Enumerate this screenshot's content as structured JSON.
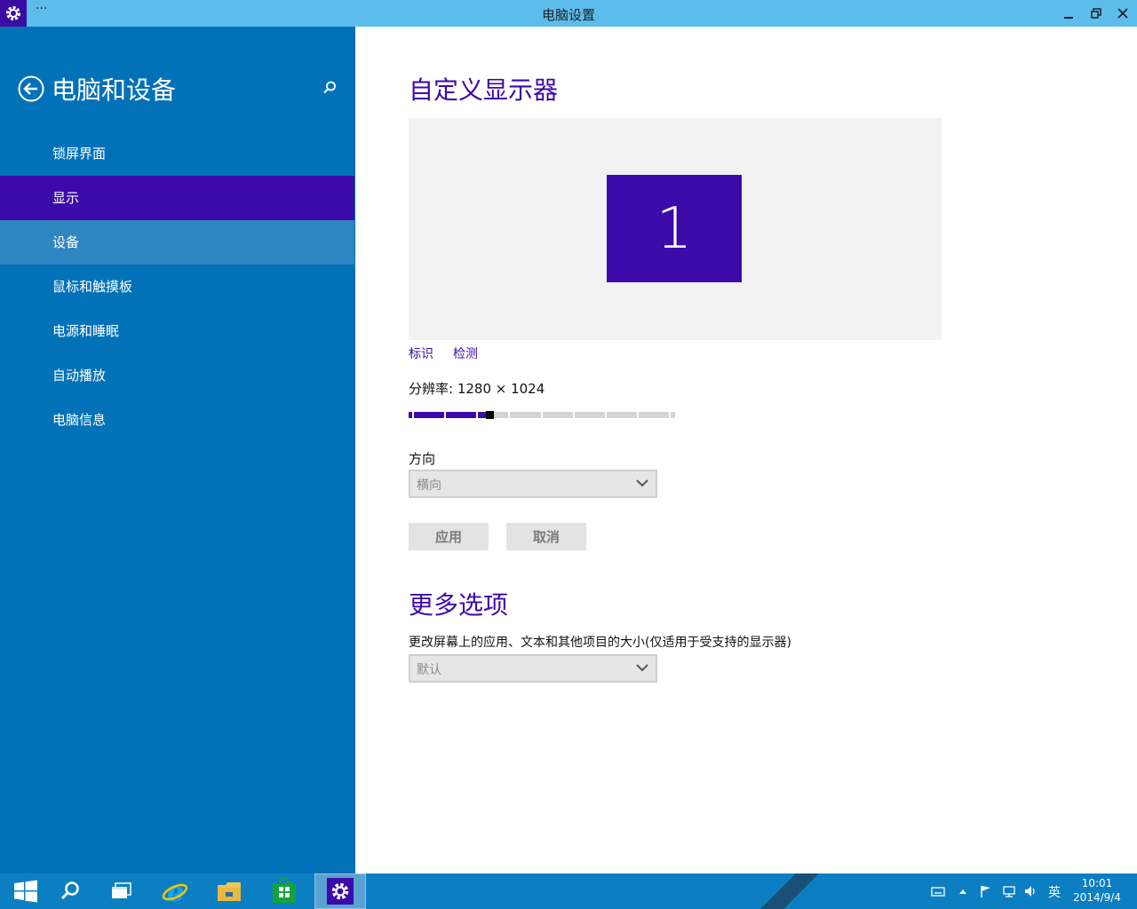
{
  "window": {
    "title": "电脑设置",
    "menu_dots": "···"
  },
  "sidebar": {
    "title": "电脑和设备",
    "items": [
      {
        "label": "锁屏界面"
      },
      {
        "label": "显示"
      },
      {
        "label": "设备"
      },
      {
        "label": "鼠标和触摸板"
      },
      {
        "label": "电源和睡眠"
      },
      {
        "label": "自动播放"
      },
      {
        "label": "电脑信息"
      }
    ],
    "selected_index": 1
  },
  "main": {
    "heading": "自定义显示器",
    "monitor_number": "1",
    "identify_link": "标识",
    "detect_link": "检测",
    "resolution_label": "分辨率: 1280 × 1024",
    "resolution_level": 0.32,
    "orientation_label": "方向",
    "orientation_value": "横向",
    "apply_button": "应用",
    "cancel_button": "取消",
    "more_heading": "更多选项",
    "size_desc": "更改屏幕上的应用、文本和其他项目的大小(仅适用于受支持的显示器)",
    "size_value": "默认"
  },
  "taskbar": {
    "ime": "英",
    "time": "10:01",
    "date": "2014/9/4"
  },
  "colors": {
    "accent": "#3b0aa9",
    "sidebar": "#0272b8",
    "titlebar": "#5cbcec",
    "taskbar": "#0b7fc1"
  }
}
